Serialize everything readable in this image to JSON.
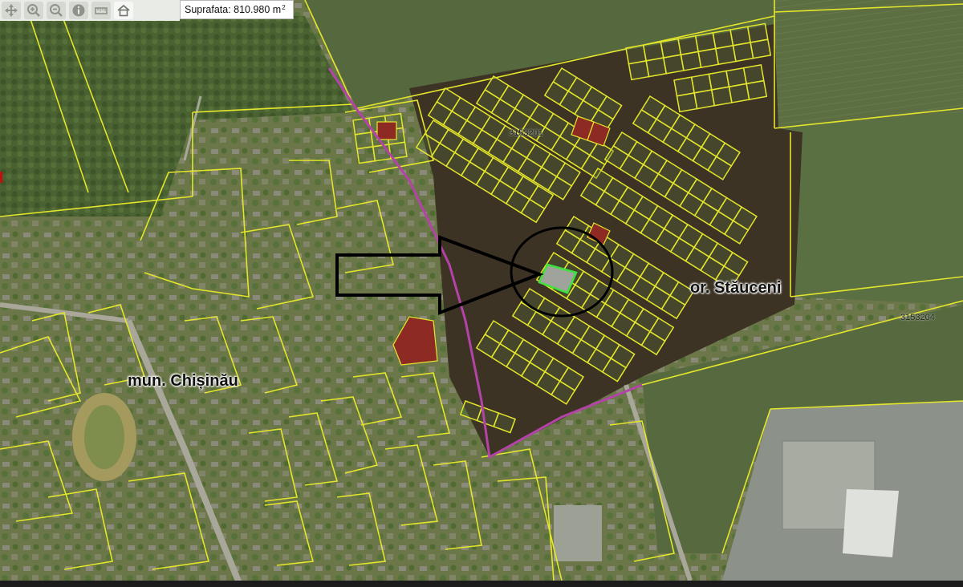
{
  "toolbar": {
    "tools": [
      {
        "icon": "pan-icon"
      },
      {
        "icon": "zoom-in-icon"
      },
      {
        "icon": "zoom-out-icon"
      },
      {
        "icon": "info-icon"
      },
      {
        "icon": "measure-icon"
      },
      {
        "icon": "home-icon"
      }
    ]
  },
  "area": {
    "label": "Suprafata: 810.980 m",
    "unit_exponent": "2"
  },
  "labels": {
    "chisinau": "mun. Chișinău",
    "stauceni": "or. Stăuceni",
    "cadastral_zone_1": "3153201",
    "cadastral_zone_2": "3153204"
  },
  "colors": {
    "parcel_boundary": "#e4e62b",
    "highlighted_parcel": "#3fe13f",
    "marked_parcels": "#8d2a24",
    "district_boundary": "#b443a8",
    "arrow_outline": "#000000",
    "field": "#566a3f",
    "soil": "#3e3426"
  }
}
